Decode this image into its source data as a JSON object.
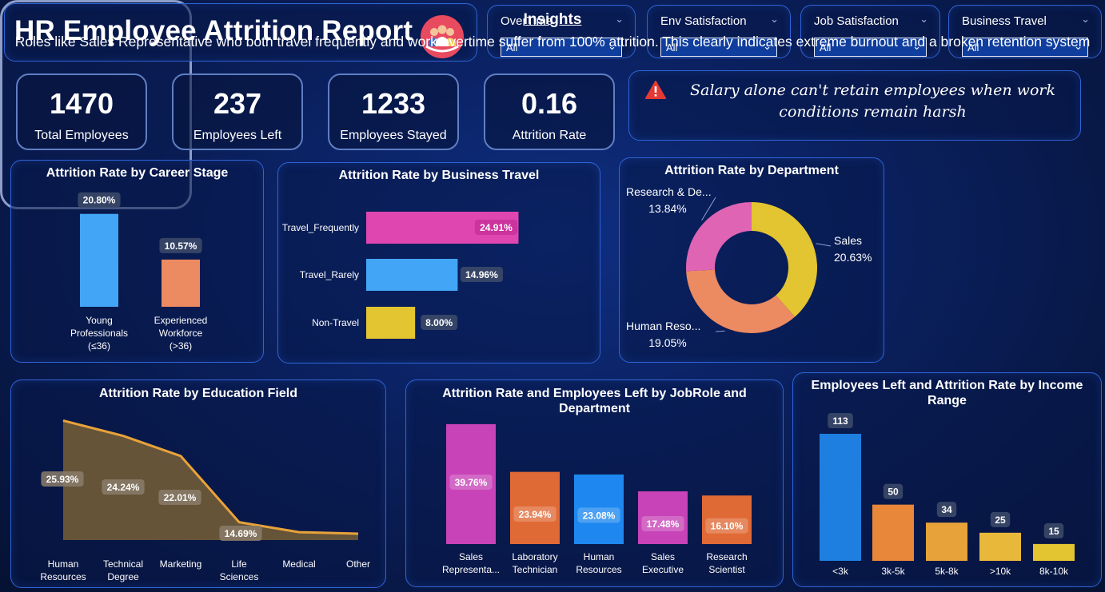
{
  "header": {
    "title": "HR Employee Attrition Report",
    "logo_icon": "employee-group-icon"
  },
  "slicers": [
    {
      "label": "OverTime",
      "value": "All"
    },
    {
      "label": "Env Satisfaction",
      "value": "All"
    },
    {
      "label": "Job Satisfaction",
      "value": "All"
    },
    {
      "label": "Business Travel",
      "value": "All"
    }
  ],
  "kpis": [
    {
      "value": "1470",
      "label": "Total Employees"
    },
    {
      "value": "237",
      "label": "Employees Left"
    },
    {
      "value": "1233",
      "label": "Employees Stayed"
    },
    {
      "value": "0.16",
      "label": "Attrition Rate"
    }
  ],
  "quote": {
    "icon": "warning-icon",
    "text": "Salary alone can't retain employees when work conditions remain harsh"
  },
  "insights": {
    "title": "Insights",
    "body": "Roles like Sales Representative who both travel frequently and work overtime suffer from 100% attrition. This clearly indicates extreme burnout and a broken retention system"
  },
  "colors": {
    "pink": "#e046b0",
    "blue": "#42a5f5",
    "yellow": "#e3c431",
    "orange": "#ec8a61",
    "gold": "#e8a23a"
  },
  "chart_data": [
    {
      "id": "career",
      "type": "bar",
      "title": "Attrition Rate by Career Stage",
      "categories": [
        "Young Professionals (≤36)",
        "Experienced Workforce (>36)"
      ],
      "category_lines": [
        [
          "Young",
          "Professionals",
          "(≤36)"
        ],
        [
          "Experienced",
          "Workforce",
          "(>36)"
        ]
      ],
      "values": [
        20.8,
        10.57
      ],
      "labels": [
        "20.80%",
        "10.57%"
      ],
      "colors": [
        "#42a5f5",
        "#ec8a61"
      ],
      "ylim": [
        0,
        22
      ]
    },
    {
      "id": "travel",
      "type": "bar",
      "orientation": "horizontal",
      "title": "Attrition Rate by Business Travel",
      "categories": [
        "Travel_Frequently",
        "Travel_Rarely",
        "Non-Travel"
      ],
      "values": [
        24.91,
        14.96,
        8.0
      ],
      "labels": [
        "24.91%",
        "14.96%",
        "8.00%"
      ],
      "colors": [
        "#e046b0",
        "#42a5f5",
        "#e3c431"
      ],
      "xlim": [
        0,
        34
      ]
    },
    {
      "id": "department",
      "type": "pie",
      "title": "Attrition Rate by Department",
      "categories": [
        "Sales",
        "Human Reso...",
        "Research & De..."
      ],
      "values": [
        20.63,
        19.05,
        13.84
      ],
      "labels": [
        "20.63%",
        "19.05%",
        "13.84%"
      ],
      "colors": [
        "#e3c431",
        "#ec8a61",
        "#e064b4"
      ]
    },
    {
      "id": "education",
      "type": "area",
      "title": "Attrition Rate by Education Field",
      "categories": [
        "Human Resources",
        "Technical Degree",
        "Marketing",
        "Life Sciences",
        "Medical",
        "Other"
      ],
      "category_lines": [
        [
          "Human",
          "Resources"
        ],
        [
          "Technical",
          "Degree"
        ],
        [
          "Marketing"
        ],
        [
          "Life",
          "Sciences"
        ],
        [
          "Medical"
        ],
        [
          "Other"
        ]
      ],
      "values": [
        25.93,
        24.24,
        22.01,
        14.69,
        13.58,
        13.41
      ],
      "labels": [
        "25.93%",
        "24.24%",
        "22.01%",
        "14.69%",
        "",
        ""
      ],
      "ylim": [
        12,
        26.5
      ]
    },
    {
      "id": "jobrole",
      "type": "bar",
      "title": "Attrition Rate and Employees Left by JobRole and Department",
      "title_lines": [
        "Attrition Rate and Employees Left by JobRole and",
        "Department"
      ],
      "categories": [
        "Sales Representa...",
        "Laboratory Technician",
        "Human Resources",
        "Sales Executive",
        "Research Scientist"
      ],
      "category_lines": [
        [
          "Sales",
          "Representa..."
        ],
        [
          "Laboratory",
          "Technician"
        ],
        [
          "Human",
          "Resources"
        ],
        [
          "Sales",
          "Executive"
        ],
        [
          "Research",
          "Scientist"
        ]
      ],
      "values": [
        39.76,
        23.94,
        23.08,
        17.48,
        16.1
      ],
      "labels": [
        "39.76%",
        "23.94%",
        "23.08%",
        "17.48%",
        "16.10%"
      ],
      "colors": [
        "#c743b7",
        "#e06a36",
        "#1e88f0",
        "#c743b7",
        "#e06a36"
      ],
      "ylim": [
        0,
        40
      ]
    },
    {
      "id": "income",
      "type": "bar",
      "title": "Employees Left and Attrition Rate by Income Range",
      "title_lines": [
        "Employees Left and Attrition Rate by Income",
        "Range"
      ],
      "categories": [
        "<3k",
        "3k-5k",
        "5k-8k",
        ">10k",
        "8k-10k"
      ],
      "values": [
        113,
        50,
        34,
        25,
        15
      ],
      "labels": [
        "113",
        "50",
        "34",
        "25",
        "15"
      ],
      "colors": [
        "#1e7fe0",
        "#e8863a",
        "#e8a23a",
        "#e8b83a",
        "#e3c431"
      ],
      "ylim": [
        0,
        113
      ]
    }
  ]
}
